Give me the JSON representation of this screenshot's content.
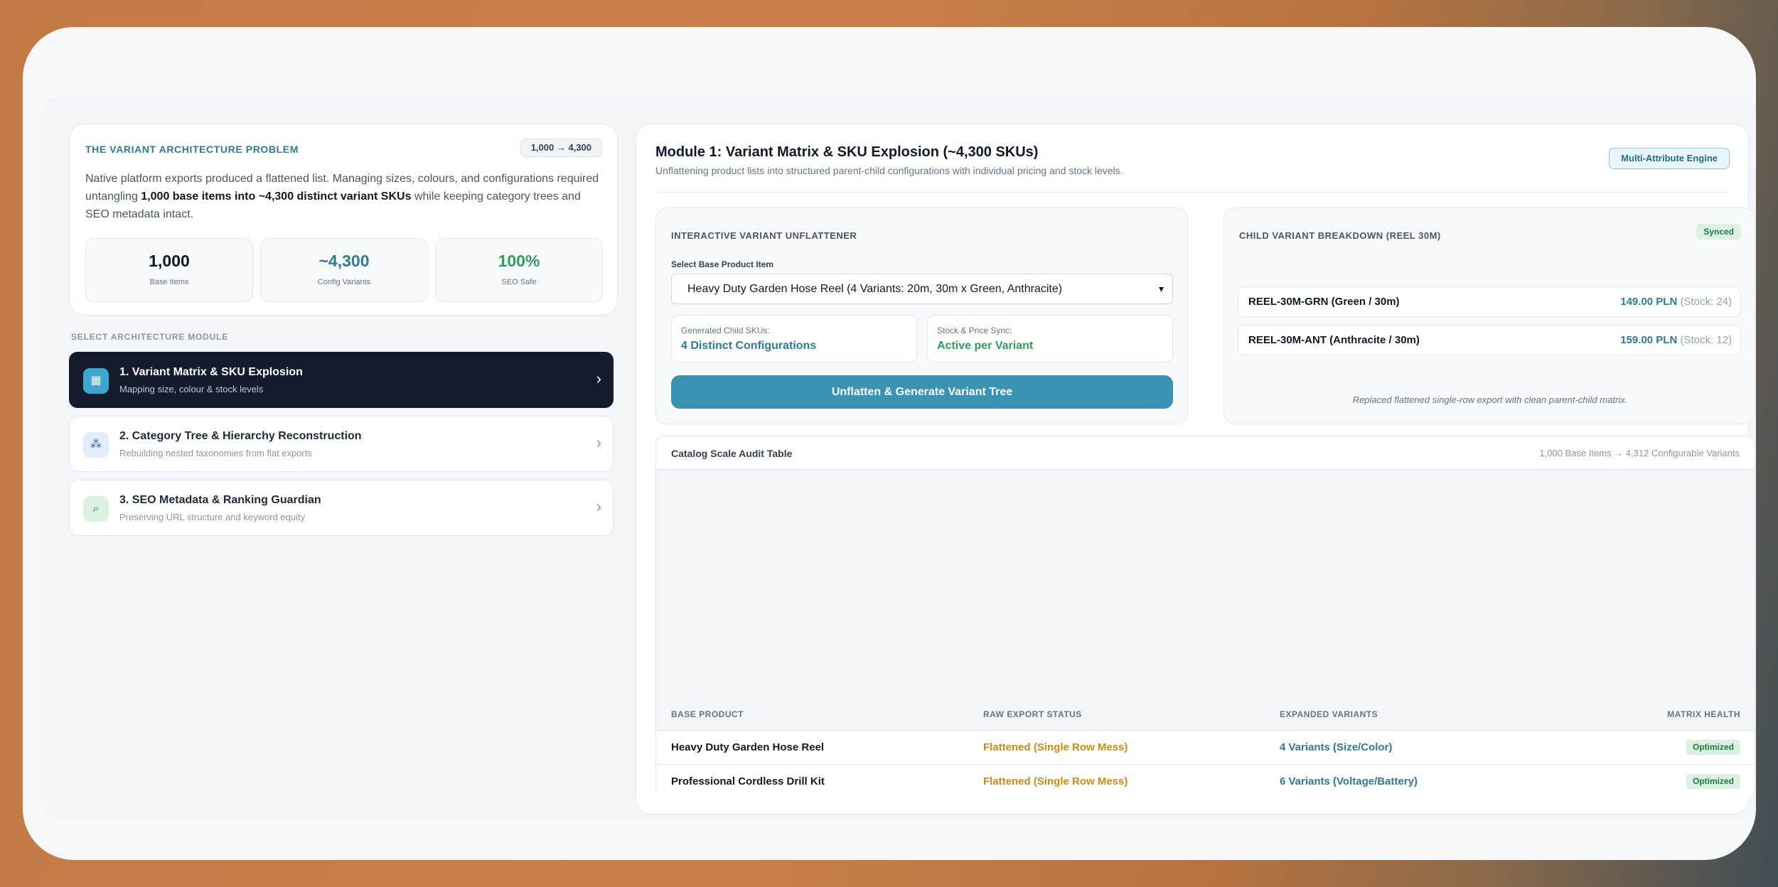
{
  "problem": {
    "title": "THE VARIANT ARCHITECTURE PROBLEM",
    "badge": "1,000 → 4,300",
    "desc_before": "Native platform exports produced a flattened list. Managing sizes, colours, and configurations required untangling ",
    "desc_bold": "1,000 base items into ~4,300 distinct variant SKUs",
    "desc_after": " while keeping category trees and SEO metadata intact.",
    "stats": [
      {
        "value": "1,000",
        "label": "Base Items"
      },
      {
        "value": "~4,300",
        "label": "Config Variants"
      },
      {
        "value": "100%",
        "label": "SEO Safe"
      }
    ]
  },
  "colors": {
    "accent": "#2b7c94",
    "success": "#2f9e5c",
    "warning": "#d08a13",
    "dark": "#141b2d"
  },
  "modules": {
    "section_label": "SELECT ARCHITECTURE MODULE",
    "items": [
      {
        "title": "1. Variant Matrix & SKU Explosion",
        "subtitle": "Mapping size, colour & stock levels",
        "icon": "table-icon",
        "glyph": "▦"
      },
      {
        "title": "2. Category Tree & Hierarchy Reconstruction",
        "subtitle": "Rebuilding nested taxonomies from flat exports",
        "icon": "hierarchy-icon",
        "glyph": "⁂"
      },
      {
        "title": "3. SEO Metadata & Ranking Guardian",
        "subtitle": "Preserving URL structure and keyword equity",
        "icon": "search-icon",
        "glyph": "⌕"
      }
    ]
  },
  "main": {
    "title": "Module 1: Variant Matrix & SKU Explosion (~4,300 SKUs)",
    "subtitle": "Unflattening product lists into structured parent-child configurations with individual pricing and stock levels.",
    "engine_badge": "Multi-Attribute Engine",
    "unflattener": {
      "title": "INTERACTIVE VARIANT UNFLATTENER",
      "select_label": "Select Base Product Item",
      "select_value": "Heavy Duty Garden Hose Reel (4 Variants: 20m, 30m x Green, Anthracite)",
      "generated_label": "Generated Child SKUs:",
      "generated_value": "4 Distinct Configurations",
      "sync_label": "Stock & Price Sync:",
      "sync_value": "Active per Variant",
      "button": "Unflatten & Generate Variant Tree"
    },
    "breakdown": {
      "title": "CHILD VARIANT BREAKDOWN (REEL 30M)",
      "badge": "Synced",
      "rows": [
        {
          "sku": "REEL-30M-GRN (Green / 30m)",
          "price": "149.00 PLN",
          "stock": "(Stock: 24)"
        },
        {
          "sku": "REEL-30M-ANT (Anthracite / 30m)",
          "price": "159.00 PLN",
          "stock": "(Stock: 12)"
        }
      ],
      "note": "Replaced flattened single-row export with clean parent-child matrix."
    },
    "audit": {
      "title": "Catalog Scale Audit Table",
      "meta": "1,000 Base Items → 4,312 Configurable Variants",
      "columns": [
        "BASE PRODUCT",
        "RAW EXPORT STATUS",
        "EXPANDED VARIANTS",
        "MATRIX HEALTH"
      ],
      "rows": [
        {
          "product": "Heavy Duty Garden Hose Reel",
          "status": "Flattened (Single Row Mess)",
          "variants": "4 Variants (Size/Color)",
          "health": "Optimized"
        },
        {
          "product": "Professional Cordless Drill Kit",
          "status": "Flattened (Single Row Mess)",
          "variants": "6 Variants (Voltage/Battery)",
          "health": "Optimized"
        }
      ]
    }
  }
}
